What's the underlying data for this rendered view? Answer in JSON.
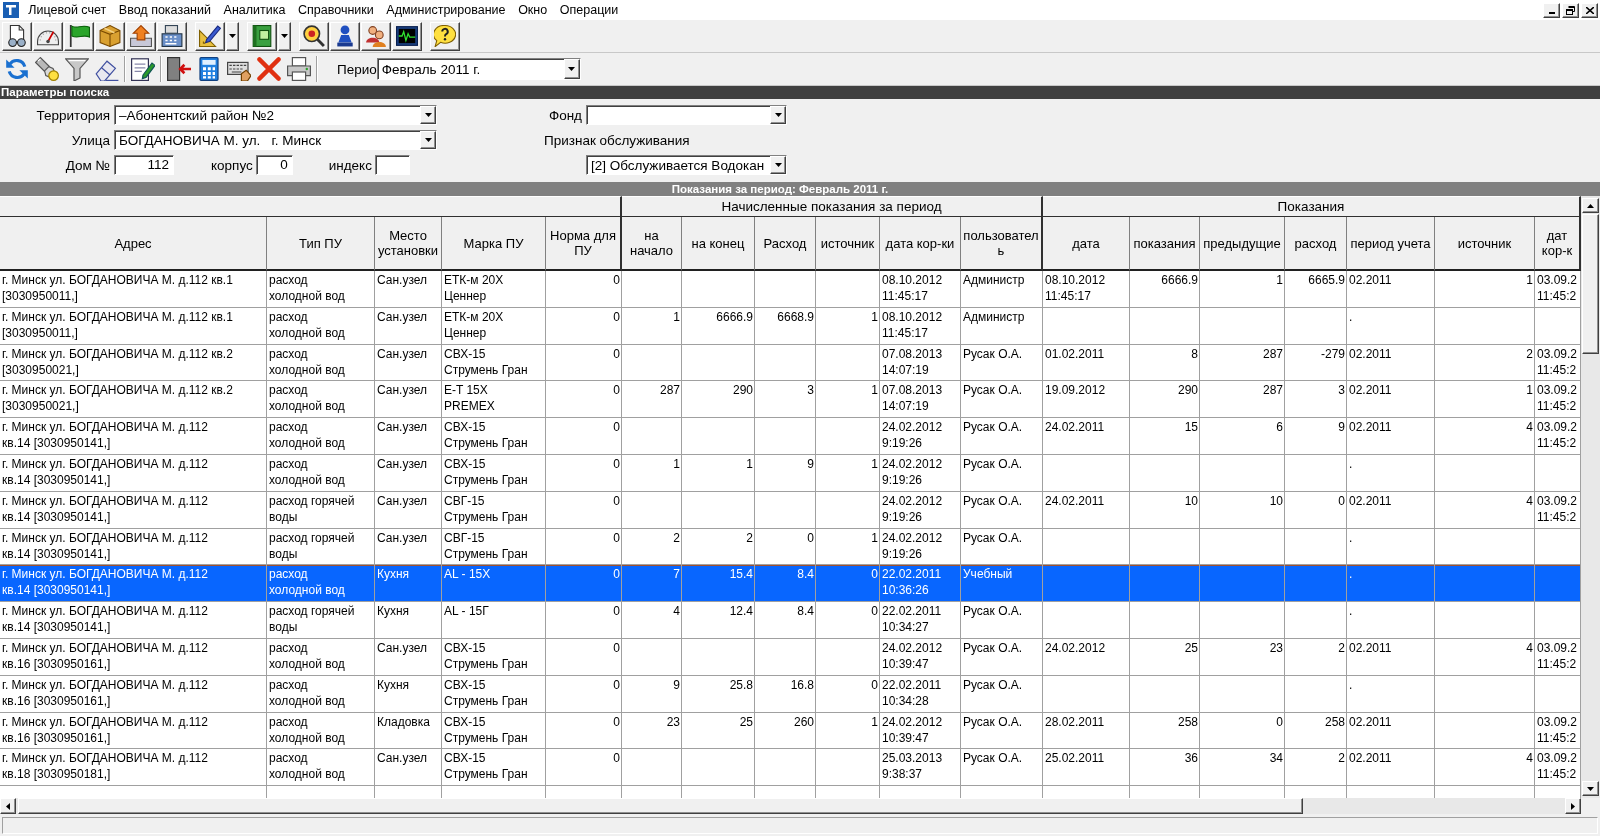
{
  "menu": [
    "Лицевой счет",
    "Ввод показаний",
    "Аналитика",
    "Справочники",
    "Администрирование",
    "Окно",
    "Операции"
  ],
  "period": {
    "label": "Перио",
    "value": "Февраль 2011 г."
  },
  "search": {
    "title": "Параметры поиска",
    "territory": {
      "label": "Территория",
      "value": "–Абонентский район №2"
    },
    "street": {
      "label": "Улица",
      "value": "БОГДАНОВИЧА М. ул.   г. Минск"
    },
    "house": {
      "label": "Дом №",
      "value": "112"
    },
    "building": {
      "label": "корпус",
      "value": "0"
    },
    "postcode": {
      "label": "индекс"
    },
    "fund": {
      "label": "Фонд"
    },
    "service": {
      "label": "Признак обслуживания",
      "value": "[2] Обслуживается Водокан"
    }
  },
  "table": {
    "title": "Показания за период: Февраль 2011 г.",
    "column_groups": [
      {
        "columns": [
          "Адрес",
          "Тип ПУ",
          "Место установки",
          "Марка ПУ",
          "Норма для ПУ"
        ]
      },
      {
        "title": "Начисленные показания за период",
        "columns": [
          "на начало",
          "на конец",
          "Расход",
          "источник",
          "дата кор-ки",
          "пользователь"
        ]
      },
      {
        "title": "Показания",
        "columns": [
          "дата",
          "показания",
          "предыдущие",
          "расход",
          "период учета",
          "источник",
          "дат кор-к"
        ]
      }
    ],
    "rows": [
      {
        "selected": false,
        "cells": [
          "г. Минск ул. БОГДАНОВИЧА М. д.112 кв.1\n[3030950011,]",
          "расход\nхолодной вод",
          "Сан.узел",
          "ЕТК-м 20Х\nЦеннер",
          "0",
          null,
          null,
          null,
          null,
          "08.10.2012\n11:45:17",
          "Администр",
          "08.10.2012\n11:45:17",
          "6666.9",
          "1",
          "6665.9",
          "02.2011",
          "1",
          "03.09.2\n11:45:2"
        ]
      },
      {
        "selected": false,
        "cells": [
          "г. Минск ул. БОГДАНОВИЧА М. д.112 кв.1\n[3030950011,]",
          "расход\nхолодной вод",
          "Сан.узел",
          "ЕТК-м 20Х\nЦеннер",
          "0",
          "1",
          "6666.9",
          "6668.9",
          "1",
          "08.10.2012\n11:45:17",
          "Администр",
          null,
          null,
          null,
          null,
          ".",
          null,
          null
        ]
      },
      {
        "selected": false,
        "cells": [
          "г. Минск ул. БОГДАНОВИЧА М. д.112 кв.2\n[3030950021,]",
          "расход\nхолодной вод",
          "Сан.узел",
          "СВХ-15\nСтрумень Гран",
          "0",
          null,
          null,
          null,
          null,
          "07.08.2013\n14:07:19",
          "Русак О.А.",
          "01.02.2011",
          "8",
          "287",
          "-279",
          "02.2011",
          "2",
          "03.09.2\n11:45:2"
        ]
      },
      {
        "selected": false,
        "cells": [
          "г. Минск ул. БОГДАНОВИЧА М. д.112 кв.2\n[3030950021,]",
          "расход\nхолодной вод",
          "Сан.узел",
          "E-T 15Х\nPREMEX",
          "0",
          "287",
          "290",
          "3",
          "1",
          "07.08.2013\n14:07:19",
          "Русак О.А.",
          "19.09.2012",
          "290",
          "287",
          "3",
          "02.2011",
          "1",
          "03.09.2\n11:45:2"
        ]
      },
      {
        "selected": false,
        "cells": [
          "г. Минск ул. БОГДАНОВИЧА М. д.112\nкв.14 [3030950141,]",
          "расход\nхолодной вод",
          "Сан.узел",
          "СВХ-15\nСтрумень Гран",
          "0",
          null,
          null,
          null,
          null,
          "24.02.2012\n9:19:26",
          "Русак О.А.",
          "24.02.2011",
          "15",
          "6",
          "9",
          "02.2011",
          "4",
          "03.09.2\n11:45:2"
        ]
      },
      {
        "selected": false,
        "cells": [
          "г. Минск ул. БОГДАНОВИЧА М. д.112\nкв.14 [3030950141,]",
          "расход\nхолодной вод",
          "Сан.узел",
          "СВХ-15\nСтрумень Гран",
          "0",
          "1",
          "1",
          "9",
          "1",
          "24.02.2012\n9:19:26",
          "Русак О.А.",
          null,
          null,
          null,
          null,
          ".",
          null,
          null
        ]
      },
      {
        "selected": false,
        "cells": [
          "г. Минск ул. БОГДАНОВИЧА М. д.112\nкв.14 [3030950141,]",
          "расход горячей\nводы",
          "Сан.узел",
          "СВГ-15\nСтрумень Гран",
          "0",
          null,
          null,
          null,
          null,
          "24.02.2012\n9:19:26",
          "Русак О.А.",
          "24.02.2011",
          "10",
          "10",
          "0",
          "02.2011",
          "4",
          "03.09.2\n11:45:2"
        ]
      },
      {
        "selected": false,
        "cells": [
          "г. Минск ул. БОГДАНОВИЧА М. д.112\nкв.14 [3030950141,]",
          "расход горячей\nводы",
          "Сан.узел",
          "СВГ-15\nСтрумень Гран",
          "0",
          "2",
          "2",
          "0",
          "1",
          "24.02.2012\n9:19:26",
          "Русак О.А.",
          null,
          null,
          null,
          null,
          ".",
          null,
          null
        ]
      },
      {
        "selected": true,
        "cells": [
          "г. Минск ул. БОГДАНОВИЧА М. д.112\nкв.14 [3030950141,]",
          "расход\nхолодной вод",
          "Кухня",
          "AL - 15Х",
          "0",
          "7",
          "15.4",
          "8.4",
          "0",
          "22.02.2011\n10:36:26",
          "Учебный",
          null,
          null,
          null,
          null,
          ".",
          null,
          null
        ]
      },
      {
        "selected": false,
        "cells": [
          "г. Минск ул. БОГДАНОВИЧА М. д.112\nкв.14 [3030950141,]",
          "расход горячей\nводы",
          "Кухня",
          "AL - 15Г",
          "0",
          "4",
          "12.4",
          "8.4",
          "0",
          "22.02.2011\n10:34:27",
          "Русак О.А.",
          null,
          null,
          null,
          null,
          ".",
          null,
          null
        ]
      },
      {
        "selected": false,
        "cells": [
          "г. Минск ул. БОГДАНОВИЧА М. д.112\nкв.16 [3030950161,]",
          "расход\nхолодной вод",
          "Сан.узел",
          "СВХ-15\nСтрумень Гран",
          "0",
          null,
          null,
          null,
          null,
          "24.02.2012\n10:39:47",
          "Русак О.А.",
          "24.02.2012",
          "25",
          "23",
          "2",
          "02.2011",
          "4",
          "03.09.2\n11:45:2"
        ]
      },
      {
        "selected": false,
        "cells": [
          "г. Минск ул. БОГДАНОВИЧА М. д.112\nкв.16 [3030950161,]",
          "расход\nхолодной вод",
          "Кухня",
          "СВХ-15\nСтрумень Гран",
          "0",
          "9",
          "25.8",
          "16.8",
          "0",
          "22.02.2011\n10:34:28",
          "Русак О.А.",
          null,
          null,
          null,
          null,
          ".",
          null,
          null
        ]
      },
      {
        "selected": false,
        "cells": [
          "г. Минск ул. БОГДАНОВИЧА М. д.112\nкв.16 [3030950161,]",
          "расход\nхолодной вод",
          "Кладовка",
          "СВХ-15\nСтрумень Гран",
          "0",
          "23",
          "25",
          "260",
          "1",
          "24.02.2012\n10:39:47",
          "Русак О.А.",
          "28.02.2011",
          "258",
          "0",
          "258",
          "02.2011",
          null,
          "03.09.2\n11:45:2"
        ]
      },
      {
        "selected": false,
        "cells": [
          "г. Минск ул. БОГДАНОВИЧА М. д.112\nкв.18 [3030950181,]",
          "расход\nхолодной вод",
          "Сан.узел",
          "СВХ-15\nСтрумень Гран",
          "0",
          null,
          null,
          null,
          null,
          "25.03.2013\n9:38:37",
          "Русак О.А.",
          "25.02.2011",
          "36",
          "34",
          "2",
          "02.2011",
          "4",
          "03.09.2\n11:45:2"
        ]
      }
    ]
  }
}
